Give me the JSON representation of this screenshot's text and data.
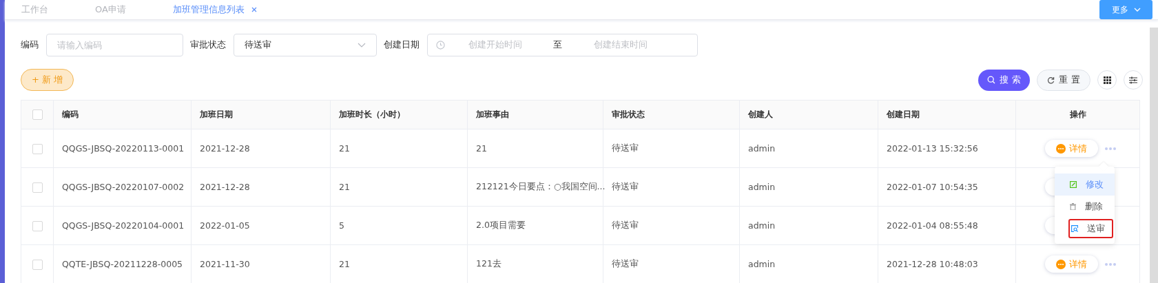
{
  "tabs": [
    {
      "label": "工作台",
      "selected": false,
      "closable": false
    },
    {
      "label": "OA申请",
      "selected": false,
      "closable": false
    },
    {
      "label": "加班管理信息列表",
      "selected": true,
      "closable": true
    }
  ],
  "more_button": "更多",
  "filters": [
    {
      "kind": "text",
      "label": "编码",
      "placeholder": "请输入编码"
    },
    {
      "kind": "select",
      "label": "审批状态",
      "value": "待送审"
    },
    {
      "kind": "daterange",
      "label": "创建日期",
      "start_placeholder": "创建开始时间",
      "separator": "至",
      "end_placeholder": "创建结束时间"
    }
  ],
  "add_button": "+ 新 增",
  "search_button": "搜 索",
  "reset_button": "重 置",
  "table": {
    "all_checked": false,
    "columns": [
      "编码",
      "加班日期",
      "加班时长（小时）",
      "加班事由",
      "审批状态",
      "创建人",
      "创建日期",
      "操作"
    ],
    "rows": [
      {
        "checked": false,
        "cells": [
          "QQGS-JBSQ-20220113-0001",
          "2021-12-28",
          "21",
          "21",
          "待送审",
          "admin",
          "2022-01-13 15:32:56"
        ],
        "detail_button": "详情"
      },
      {
        "checked": false,
        "cells": [
          "QQGS-JBSQ-20220107-0002",
          "2021-12-28",
          "21",
          "212121今日要点：○我国空间...",
          "待送审",
          "admin",
          "2022-01-07 10:54:35"
        ]
      },
      {
        "checked": false,
        "cells": [
          "QQGS-JBSQ-20220104-0001",
          "2022-01-05",
          "5",
          "2.0项目需要",
          "待送审",
          "admin",
          "2022-01-04 08:55:48"
        ]
      },
      {
        "checked": false,
        "cells": [
          "QQTE-JBSQ-20211228-0005",
          "2021-11-30",
          "21",
          "121去",
          "待送审",
          "admin",
          "2021-12-28 10:48:03"
        ],
        "detail_button": "详情"
      }
    ]
  },
  "action_menu": [
    {
      "kind": "edit",
      "label": "修改",
      "selected": true,
      "outlined": false
    },
    {
      "kind": "delete",
      "label": "删除",
      "selected": false,
      "outlined": false
    },
    {
      "kind": "submit",
      "label": "送审",
      "selected": false,
      "outlined": true
    }
  ]
}
